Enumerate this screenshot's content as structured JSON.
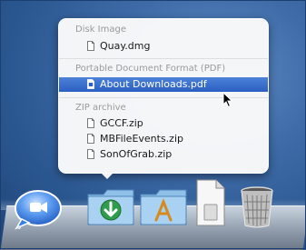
{
  "stack_menu": {
    "groups": [
      {
        "header": "Disk Image",
        "items": [
          {
            "label": "Quay.dmg"
          }
        ]
      },
      {
        "header": "Portable Document Format (PDF)",
        "items": [
          {
            "label": "About Downloads.pdf",
            "selected": true
          }
        ]
      },
      {
        "header": "ZIP archive",
        "items": [
          {
            "label": "GCCF.zip"
          },
          {
            "label": "MBFileEvents.zip"
          },
          {
            "label": "SonOfGrab.zip"
          }
        ]
      }
    ]
  },
  "dock": {
    "items": [
      {
        "icon": "ichat-icon"
      },
      {
        "icon": "downloads-stack-icon"
      },
      {
        "icon": "applications-folder-icon"
      },
      {
        "icon": "document-icon"
      },
      {
        "icon": "trash-icon"
      }
    ]
  },
  "colors": {
    "selection": "#3a70cf",
    "desktop": "#3f6ca8",
    "header_text": "#9a9a9a"
  }
}
